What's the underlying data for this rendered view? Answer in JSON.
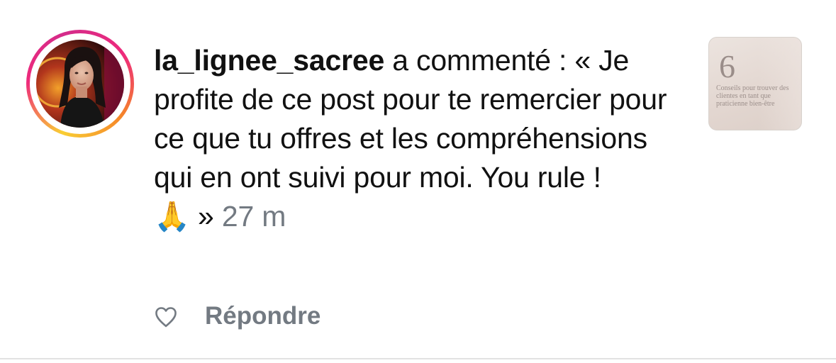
{
  "comment": {
    "username": "la_lignee_sacree",
    "action": " a commenté : ",
    "text": "« Je profite de ce post pour te remercier pour ce que tu offres et les compréhensions qui en ont suivi pour moi. You rule !",
    "emoji": "🙏",
    "closing": " » ",
    "timestamp": "27 m"
  },
  "thumbnail": {
    "number": "6",
    "caption": "Conseils pour trouver des clientes en tant que praticienne bien-être"
  },
  "actions": {
    "reply_label": "Répondre",
    "like_icon": "heart-outline-icon"
  },
  "colors": {
    "text": "#111111",
    "muted": "#737a82",
    "ring_start": "#f9ce34",
    "ring_mid": "#ee2a7b"
  }
}
